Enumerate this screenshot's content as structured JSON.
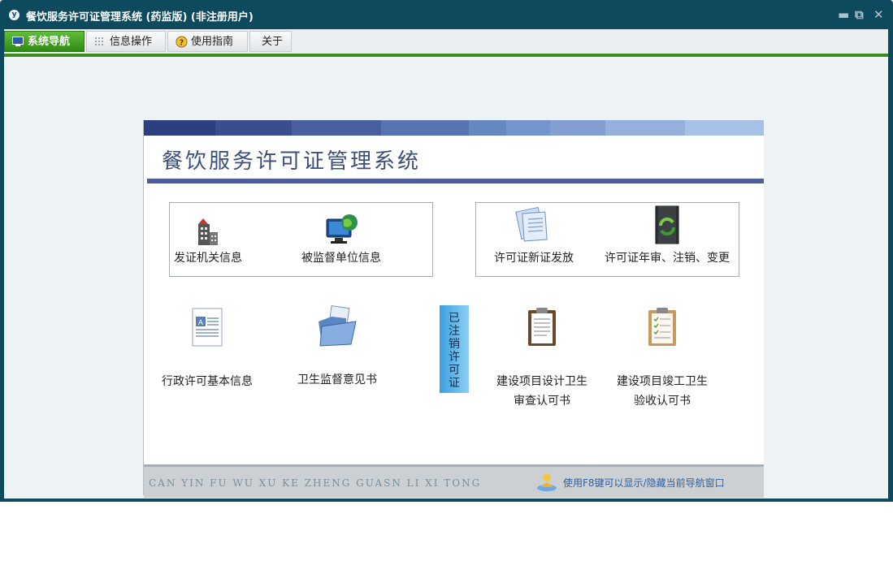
{
  "window": {
    "title": "餐饮服务许可证管理系统 (药监版) (非注册用户)",
    "app_icon": "y",
    "controls": {
      "minimize": "▬",
      "restore": "⧉",
      "close": "✕"
    }
  },
  "menu": {
    "tabs": [
      {
        "label": "系统导航",
        "icon": "monitor-icon",
        "active": true
      },
      {
        "label": "信息操作",
        "icon": "grid-icon",
        "active": false
      },
      {
        "label": "使用指南",
        "icon": "help-icon",
        "active": false
      },
      {
        "label": "关于",
        "icon": "",
        "active": false
      }
    ]
  },
  "panel": {
    "title": "餐饮服务许可证管理系统",
    "stripe_colors": [
      "#2c3f7e",
      "#3a4e8e",
      "#4860a0",
      "#5674b2",
      "#6588c0",
      "#7394cc",
      "#839fd2",
      "#95b0dc",
      "#a7c0e6"
    ],
    "items": {
      "issuing_agency": "发证机关信息",
      "supervised_unit": "被监督单位信息",
      "new_license": "许可证新证发放",
      "annual_review": "许可证年审、注销、变更",
      "admin_license": "行政许可基本信息",
      "health_opinion": "卫生监督意见书",
      "cancelled_license": "已注销许可证",
      "design_review_line1": "建设项目设计卫生",
      "design_review_line2": "审查认可书",
      "completion_line1": "建设项目竣工卫生",
      "completion_line2": "验收认可书"
    },
    "footer": {
      "pinyin": "CAN YIN FU WU XU KE ZHENG GUASN LI XI TONG",
      "hint": "使用F8键可以显示/隐藏当前导航窗口"
    }
  }
}
